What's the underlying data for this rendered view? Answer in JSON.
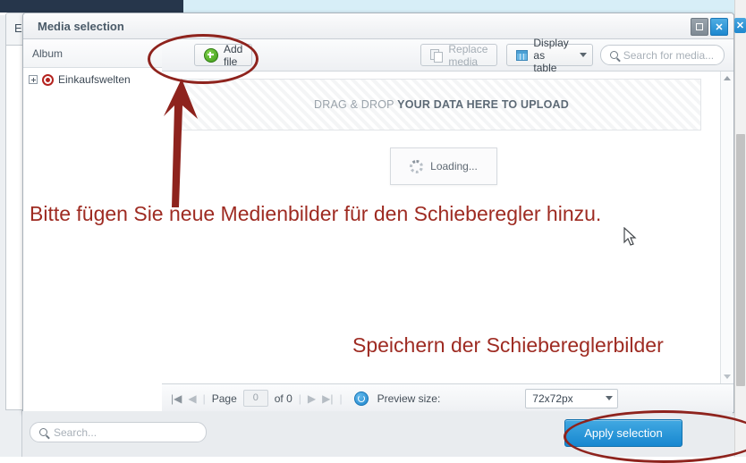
{
  "background": {
    "tab_label": "E"
  },
  "dialog": {
    "title": "Media selection",
    "window_buttons": {
      "maximize": "maximize-restore",
      "close_label": "✕"
    },
    "tree": {
      "header": "Album",
      "items": [
        {
          "label": "Einkaufswelten",
          "icon": "target-icon",
          "expander": "plus-box"
        }
      ]
    },
    "toolbar": {
      "add_file_label": "Add file",
      "replace_media_label": "Replace media",
      "display_as_table_label": "Display as table",
      "search_media_placeholder": "Search for media..."
    },
    "dropzone": {
      "text_light": "DRAG & DROP ",
      "text_strong": "YOUR DATA HERE TO UPLOAD"
    },
    "loading": {
      "label": "Loading..."
    },
    "pagination": {
      "first_label": "|◀",
      "prev_label": "◀",
      "page_label": "Page",
      "page_value": "0",
      "of_label": "of 0",
      "next_label": "▶",
      "last_label": "▶|",
      "refresh_icon": "refresh-icon",
      "preview_size_label": "Preview size:",
      "preview_size_value": "72x72px"
    },
    "footer": {
      "search_placeholder": "Search...",
      "apply_label": "Apply selection"
    }
  },
  "annotations": {
    "color": "#9e2b22",
    "text_1": "Bitte fügen Sie neue Medienbilder für den Schieberegler hinzu.",
    "text_2": "Speichern der Schiebereglerbilder",
    "arrow": "up-arrow-to-add-file",
    "ellipse_1": "highlight-add-file-button",
    "ellipse_2": "highlight-apply-selection-button"
  }
}
